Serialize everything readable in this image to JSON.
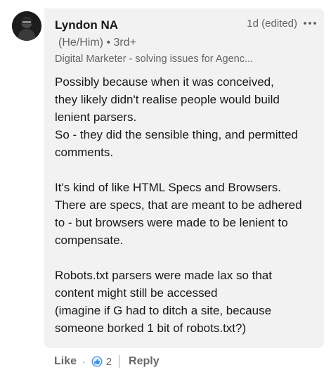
{
  "comment": {
    "author": {
      "name": "Lyndon NA",
      "pronouns": "(He/Him)",
      "connection": "3rd+",
      "headline": "Digital Marketer - solving issues for Agenc..."
    },
    "timestamp": "1d (edited)",
    "body": {
      "paragraphs": [
        [
          "Possibly because when it was conceived,",
          "they likely didn't realise people would build",
          "lenient parsers.",
          "So - they did the sensible thing, and permitted",
          "comments."
        ],
        [
          "It's kind of like HTML Specs and Browsers.",
          "There are specs, that are meant to be adhered",
          "to - but browsers were made to be lenient to",
          "compensate."
        ],
        [
          "Robots.txt parsers were made lax so that",
          "content might still be accessed",
          "(imagine if G had to ditch a site, because",
          "someone borked 1 bit of robots.txt?)"
        ]
      ]
    },
    "actions": {
      "like_label": "Like",
      "reaction_count": "2",
      "reply_label": "Reply"
    },
    "icons": {
      "more": "more-horizontal-icon",
      "reaction": "like-reaction-icon",
      "avatar": "avatar-image"
    },
    "colors": {
      "bubble_background": "#f2f2f2",
      "reaction_blue": "#378fe9",
      "text_secondary": "#666666"
    }
  }
}
